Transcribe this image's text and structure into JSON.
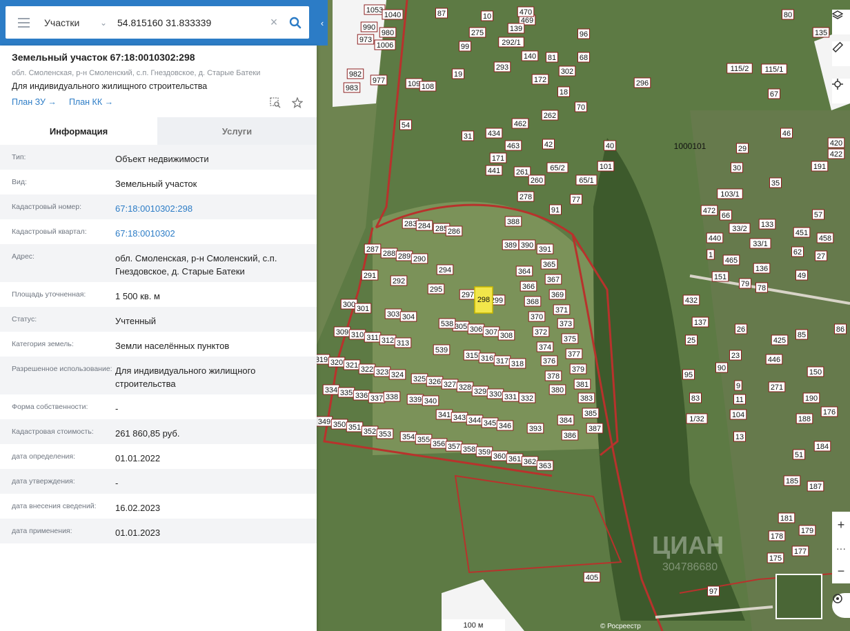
{
  "search": {
    "type_label": "Участки",
    "query": "54.815160 31.833339"
  },
  "object": {
    "title": "Земельный участок 67:18:0010302:298",
    "address_short": "обл. Смоленская, р-н Смоленский, с.п. Гнездовское, д. Старые Батеки",
    "purpose": "Для индивидуального жилищного строительства",
    "link_plan_zu": "План ЗУ →",
    "link_plan_kk": "План КК →"
  },
  "tabs": [
    {
      "label": "Информация",
      "active": true
    },
    {
      "label": "Услуги",
      "active": false
    }
  ],
  "properties": [
    {
      "key": "Тип:",
      "value": "Объект недвижимости"
    },
    {
      "key": "Вид:",
      "value": "Земельный участок"
    },
    {
      "key": "Кадастровый номер:",
      "value": "67:18:0010302:298",
      "link": true
    },
    {
      "key": "Кадастровый квартал:",
      "value": "67:18:0010302",
      "link": true
    },
    {
      "key": "Адрес:",
      "value": "обл. Смоленская, р-н Смоленский, с.п. Гнездовское, д. Старые Батеки"
    },
    {
      "key": "Площадь уточненная:",
      "value": "1 500 кв. м"
    },
    {
      "key": "Статус:",
      "value": "Учтенный"
    },
    {
      "key": "Категория земель:",
      "value": "Земли населённых пунктов"
    },
    {
      "key": "Разрешенное использование:",
      "value": "Для индивидуального жилищного строительства"
    },
    {
      "key": "Форма собственности:",
      "value": "-"
    },
    {
      "key": "Кадастровая стоимость:",
      "value": "261 860,85 руб."
    },
    {
      "key": "дата определения:",
      "value": "01.01.2022"
    },
    {
      "key": "дата утверждения:",
      "value": "-"
    },
    {
      "key": "дата внесения сведений:",
      "value": "16.02.2023"
    },
    {
      "key": "дата применения:",
      "value": "01.01.2023"
    }
  ],
  "map": {
    "scale_label": "100 м",
    "watermark": "ЦИАН",
    "watermark_id": "304786680",
    "copyright": "© Росреестр",
    "quarter_label": "1000101",
    "selected_plot": "298",
    "plots": [
      "283",
      "284",
      "285",
      "286",
      "287",
      "288",
      "289",
      "290",
      "291",
      "292",
      "293",
      "294",
      "295",
      "296",
      "297",
      "299",
      "300",
      "301",
      "302",
      "303",
      "304",
      "305",
      "306",
      "307",
      "308",
      "309",
      "310",
      "311",
      "312",
      "313",
      "315",
      "316",
      "317",
      "318",
      "319",
      "320",
      "321",
      "322",
      "323",
      "324",
      "325",
      "326",
      "327",
      "328",
      "329",
      "330",
      "331",
      "332",
      "334",
      "335",
      "336",
      "337",
      "338",
      "339",
      "340",
      "341",
      "343",
      "344",
      "345",
      "346",
      "349",
      "350",
      "351",
      "352",
      "353",
      "354",
      "355",
      "356",
      "357",
      "358",
      "359",
      "360",
      "361",
      "362",
      "363",
      "364",
      "365",
      "366",
      "367",
      "368",
      "369",
      "370",
      "371",
      "372",
      "373",
      "374",
      "375",
      "376",
      "377",
      "378",
      "379",
      "380",
      "381",
      "383",
      "384",
      "385",
      "386",
      "387",
      "388",
      "389",
      "390",
      "391",
      "393",
      "538",
      "539",
      "405",
      "87",
      "10",
      "275",
      "283",
      "284",
      "99",
      "19",
      "109",
      "108",
      "982",
      "983",
      "977",
      "1053",
      "1040",
      "990",
      "980",
      "973",
      "1006",
      "469",
      "470",
      "139",
      "292/1",
      "140",
      "293",
      "81",
      "68",
      "302",
      "96",
      "70",
      "18",
      "172",
      "262",
      "42",
      "462",
      "434",
      "171",
      "441",
      "463",
      "261",
      "260",
      "65/2",
      "65/1",
      "278",
      "91",
      "77",
      "101",
      "40",
      "296",
      "54",
      "31",
      "135",
      "80",
      "115/2",
      "115/1",
      "67",
      "46",
      "29",
      "30",
      "420",
      "422",
      "191",
      "35",
      "103/1",
      "66",
      "472",
      "133",
      "33/2",
      "33/1",
      "57",
      "451",
      "458",
      "440",
      "465",
      "62",
      "27",
      "136",
      "151",
      "79",
      "78",
      "49",
      "432",
      "285",
      "137",
      "26",
      "425",
      "25",
      "23",
      "446",
      "95",
      "90",
      "271",
      "9",
      "11",
      "104",
      "13",
      "83",
      "1/32",
      "190",
      "150",
      "176",
      "188",
      "184",
      "187",
      "185",
      "181",
      "178",
      "179",
      "175",
      "177",
      "97",
      "51",
      "1",
      "96",
      "86",
      "85"
    ]
  }
}
